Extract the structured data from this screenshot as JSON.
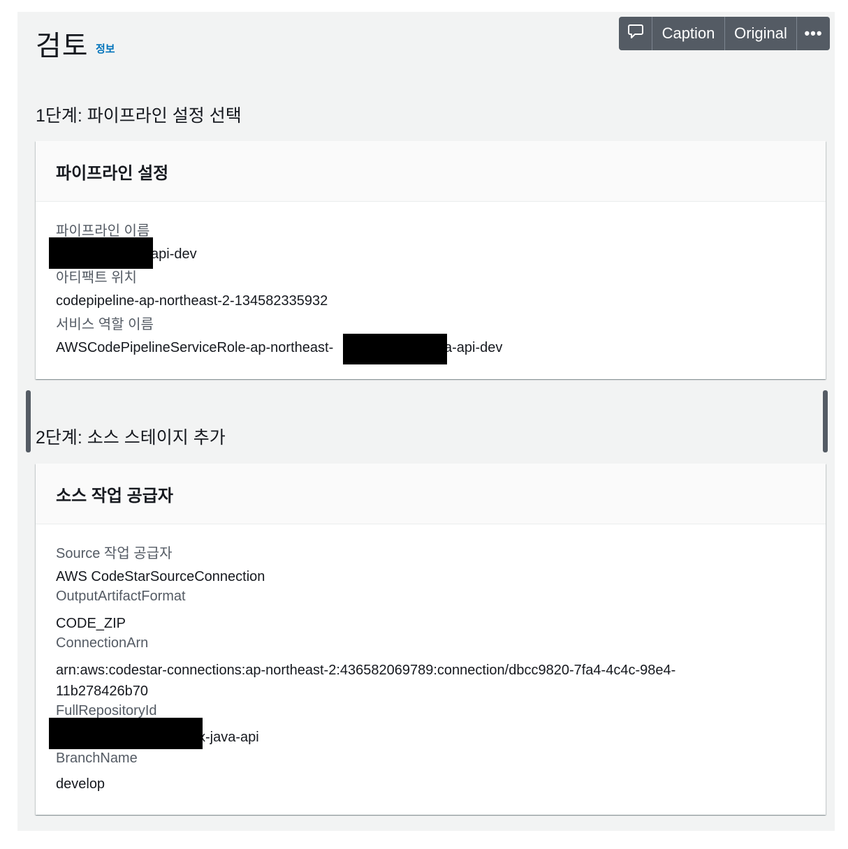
{
  "header": {
    "title": "검토",
    "info_link": "정보"
  },
  "toolbar": {
    "comment_icon": "comment-icon",
    "caption_label": "Caption",
    "original_label": "Original",
    "more_label": "•••"
  },
  "step1": {
    "heading": "1단계: 파이프라인 설정 선택",
    "card_title": "파이프라인 설정",
    "fields": [
      {
        "label": "파이프라인 이름",
        "value": "api-dev"
      },
      {
        "label": "아티팩트 위치",
        "value": "codepipeline-ap-northeast-2-134582335932"
      },
      {
        "label": "서비스 역할 이름",
        "value_prefix": "AWSCodePipelineServiceRole-ap-northeast-",
        "value_suffix": "a-api-dev"
      }
    ]
  },
  "step2": {
    "heading": "2단계: 소스 스테이지 추가",
    "card_title": "소스 작업 공급자",
    "fields": [
      {
        "label": "Source 작업 공급자",
        "value": "AWS CodeStarSourceConnection"
      },
      {
        "label": "OutputArtifactFormat",
        "value": "CODE_ZIP"
      },
      {
        "label": "ConnectionArn",
        "value_line1": "arn:aws:codestar-connections:ap-northeast-2:436582069789:connection/dbcc9820-7fa4-4c4c-98e4-",
        "value_line2": "11b278426b70"
      },
      {
        "label": "FullRepositoryId",
        "value": "x-java-api"
      },
      {
        "label": "BranchName",
        "value": "develop"
      }
    ]
  },
  "colors": {
    "page_background": "#f2f3f3",
    "toolbar": "#545b64",
    "info_link": "#0073bb",
    "redaction": "#000000"
  }
}
